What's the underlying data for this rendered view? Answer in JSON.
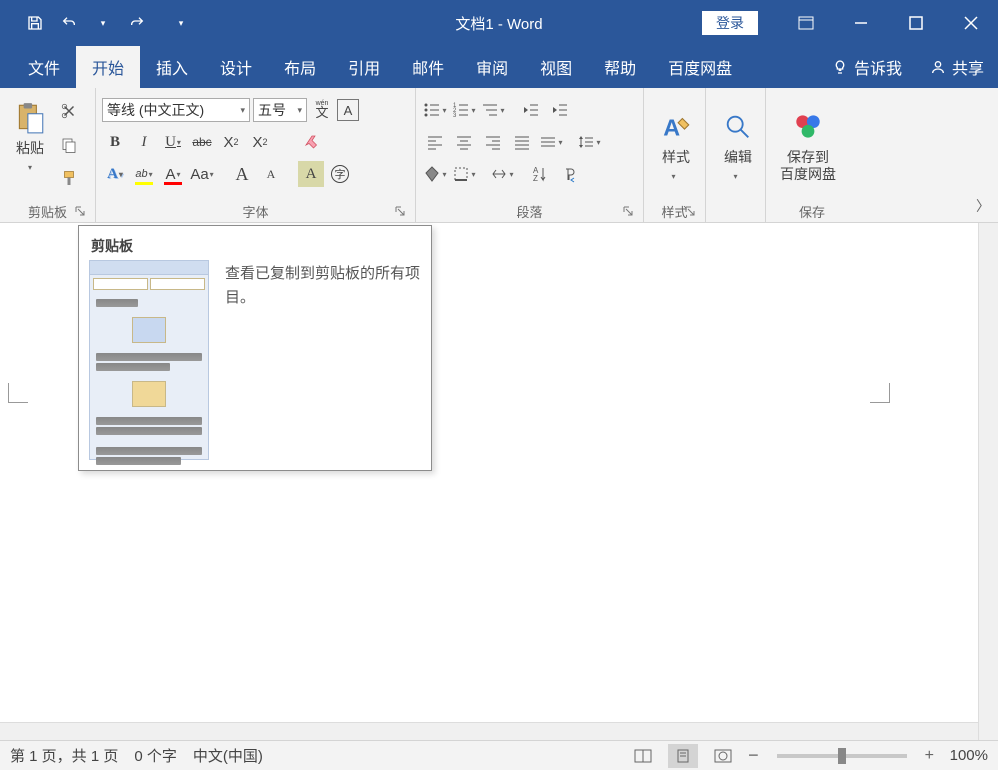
{
  "title": "文档1  -  Word",
  "login": "登录",
  "tabs": {
    "file": "文件",
    "home": "开始",
    "insert": "插入",
    "design": "设计",
    "layout": "布局",
    "references": "引用",
    "mailings": "邮件",
    "review": "审阅",
    "view": "视图",
    "help": "帮助",
    "baidu": "百度网盘",
    "tellme": "告诉我",
    "share": "共享"
  },
  "ribbon": {
    "clipboard": {
      "label": "剪贴板",
      "paste": "粘贴"
    },
    "font": {
      "label": "字体",
      "name": "等线 (中文正文)",
      "size": "五号",
      "phonetic_top": "wén",
      "phonetic_char": "文",
      "border_char": "A",
      "bold": "B",
      "italic": "I",
      "underline": "U",
      "strikethrough": "abc",
      "sub": "X",
      "sub2": "2",
      "sup": "X",
      "sup2": "2",
      "texteffect": "A",
      "highlight": "ab",
      "fontcolor": "A",
      "case": "Aa",
      "grow": "A",
      "shrink": "A",
      "chareffect": "A",
      "circle": "字"
    },
    "paragraph": {
      "label": "段落"
    },
    "styles": {
      "label": "样式",
      "button": "样式"
    },
    "editing": {
      "label": "编辑"
    },
    "save": {
      "label": "保存",
      "button_line1": "保存到",
      "button_line2": "百度网盘"
    }
  },
  "tooltip": {
    "title": "剪贴板",
    "body": "查看已复制到剪贴板的所有项目。"
  },
  "status": {
    "page": "第 1 页，共 1 页",
    "words": "0 个字",
    "lang": "中文(中国)",
    "zoom_minus": "−",
    "zoom_plus": "+",
    "zoom": "100%"
  }
}
